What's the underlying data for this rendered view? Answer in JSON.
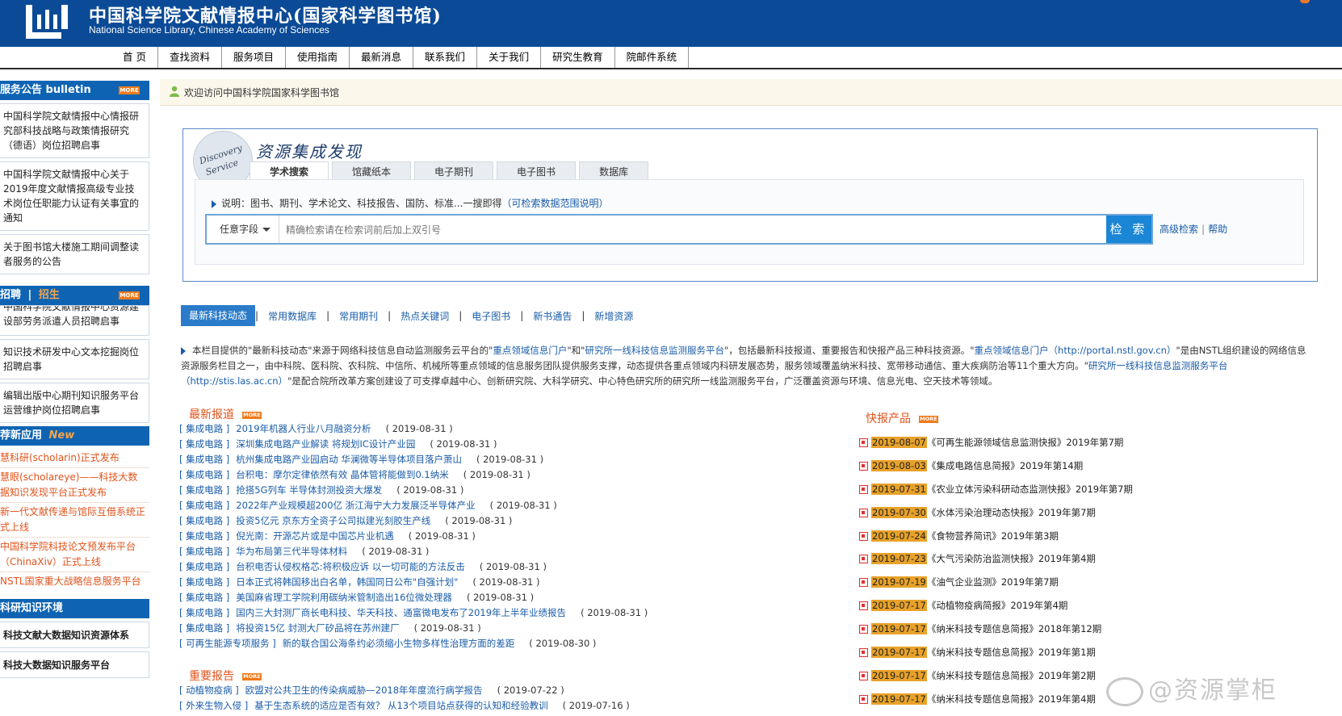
{
  "header": {
    "title": "中国科学院文献情报中心(国家科学图书馆)",
    "subtitle": "National Science Library, Chinese Academy of Sciences"
  },
  "nav": {
    "items": [
      "首 页",
      "查找资料",
      "服务项目",
      "使用指南",
      "最新消息",
      "联系我们",
      "关于我们",
      "研究生教育",
      "院邮件系统"
    ]
  },
  "sidebar": {
    "bulletin_title": "服务公告 bulletin",
    "more_label": "MORE",
    "bulletin_items": [
      "中国科学院文献情报中心情报研究部科技战略与政策情报研究（德语）岗位招聘启事",
      "中国科学院文献情报中心关于2019年度文献情报高级专业技术岗位任职能力认证有关事宜的通知",
      "关于图书馆大楼施工期间调整读者服务的公告"
    ],
    "recruit_title": "招聘",
    "recruit_title_alt": "招生",
    "recruit_partial": "中国科学院文献情报中心资源建设部劳务派遣人员招聘启事",
    "recruit_items": [
      "知识技术研发中心文本挖掘岗位招聘启事",
      "编辑出版中心期刊知识服务平台运营维护岗位招聘启事"
    ],
    "apps_title": "荐新应用",
    "apps_new": "New",
    "apps_items": [
      "慧科研(scholarin)正式发布",
      "慧眼(scholareye)——科技大数据知识发现平台正式发布",
      "新一代文献传递与馆际互借系统正式上线",
      "中国科学院科技论文预发布平台（ChinaXiv）正式上线",
      "NSTL国家重大战略信息服务平台"
    ],
    "knowledge_title": "科研知识环境",
    "knowledge_items": [
      "科技文献大数据知识资源体系",
      "科技大数据知识服务平台"
    ]
  },
  "welcome": {
    "text": "欢迎访问中国科学院国家科学图书馆"
  },
  "search_panel": {
    "badge_line1": "Discovery",
    "badge_line2": "Service",
    "title": "资源集成发现",
    "tabs": [
      "学术搜索",
      "馆藏纸本",
      "电子期刊",
      "电子图书",
      "数据库"
    ],
    "active_tab": 0,
    "hint": "说明：图书、期刊、学术论文、科技报告、国防、标准...一搜即得",
    "hint_link": "（可检索数据范围说明）",
    "field_select": "任意字段",
    "placeholder": "精确检索请在检索词前后加上双引号",
    "search_button": "检 索",
    "advanced": "高级检索",
    "help": "帮助"
  },
  "news_tabs": {
    "items": [
      "最新科技动态",
      "常用数据库",
      "常用期刊",
      "热点关键词",
      "电子图书",
      "新书通告",
      "新增资源"
    ],
    "active": 0
  },
  "intro": {
    "p1": "本栏目提供的\"最新科技动态\"来源于网络科技信息自动监测服务云平台的\"",
    "l1": "重点领域信息门户",
    "p2": "\"和\"",
    "l2": "研究所一线科技信息监测服务平台",
    "p3": "\"，包括最新科技报道、重要报告和快报产品三种科技资源。\"",
    "l3": "重点领域信息门户（http://portal.nstl.gov.cn）",
    "p4": "\"是由NSTL组织建设的网络信息资源服务栏目之一，由中科院、医科院、农科院、中信所、机械所等重点领域的信息服务团队提供服务支撑，动态提供各重点领域内科研发展态势，服务领域覆盖纳米科技、宽带移动通信、重大疾病防治等11个重大方向。\"",
    "l4": "研究所一线科技信息监测服务平台（http://stis.las.ac.cn）",
    "p5": "\"是配合院所改革方案创建设了可支撑卓越中心、创新研究院、大科学研究、中心特色研究所的研究所一线监测服务平台，广泛覆盖资源与环境、信息光电、空天技术等领域。"
  },
  "latest": {
    "title": "最新报道",
    "items": [
      {
        "cat": "[ 集成电路 ]",
        "title": "2019年机器人行业八月融资分析",
        "date": "( 2019-08-31 )"
      },
      {
        "cat": "[ 集成电路 ]",
        "title": "深圳集成电路产业解读 将规划IC设计产业园",
        "date": "( 2019-08-31 )"
      },
      {
        "cat": "[ 集成电路 ]",
        "title": "杭州集成电路产业园启动 华澜微等半导体项目落户萧山",
        "date": "( 2019-08-31 )"
      },
      {
        "cat": "[ 集成电路 ]",
        "title": "台积电：摩尔定律依然有效 晶体管将能做到0.1纳米",
        "date": "( 2019-08-31 )"
      },
      {
        "cat": "[ 集成电路 ]",
        "title": "抢搭5G列车 半导体封测投资大爆发",
        "date": "( 2019-08-31 )"
      },
      {
        "cat": "[ 集成电路 ]",
        "title": "2022年产业规模超200亿 浙江海宁大力发展泛半导体产业",
        "date": "( 2019-08-31 )"
      },
      {
        "cat": "[ 集成电路 ]",
        "title": "投资5亿元 京东方全资子公司拟建光刻胶生产线",
        "date": "( 2019-08-31 )"
      },
      {
        "cat": "[ 集成电路 ]",
        "title": "倪光南：开源芯片或是中国芯片业机遇",
        "date": "( 2019-08-31 )"
      },
      {
        "cat": "[ 集成电路 ]",
        "title": "华为布局第三代半导体材料",
        "date": "( 2019-08-31 )"
      },
      {
        "cat": "[ 集成电路 ]",
        "title": "台积电否认侵权格芯:将积极应诉 以一切可能的方法反击",
        "date": "( 2019-08-31 )"
      },
      {
        "cat": "[ 集成电路 ]",
        "title": "日本正式将韩国移出白名单，韩国同日公布\"自强计划\"",
        "date": "( 2019-08-31 )"
      },
      {
        "cat": "[ 集成电路 ]",
        "title": "美国麻省理工学院利用碳纳米管制造出16位微处理器",
        "date": "( 2019-08-31 )"
      },
      {
        "cat": "[ 集成电路 ]",
        "title": "国内三大封测厂商长电科技、华天科技、通富微电发布了2019年上半年业绩报告",
        "date": "( 2019-08-31 )"
      },
      {
        "cat": "[ 集成电路 ]",
        "title": "将投资15亿 封测大厂矽品将在苏州建厂",
        "date": "( 2019-08-31 )"
      },
      {
        "cat": "[ 可再生能源专项服务 ]",
        "title": "新的联合国公海条约必须缩小生物多样性治理方面的差距",
        "date": "( 2019-08-30 )"
      }
    ]
  },
  "reports": {
    "title": "重要报告",
    "items": [
      {
        "cat": "[ 动植物疫病 ]",
        "title": "欧盟对公共卫生的传染病威胁—2018年年度流行病学报告",
        "date": "( 2019-07-22 )"
      },
      {
        "cat": "[ 外来生物入侵 ]",
        "title": "基于生态系统的适应是否有效？ 从13个项目站点获得的认知和经验教训",
        "date": "( 2019-07-16 )"
      }
    ]
  },
  "kuaibao": {
    "title": "快报产品",
    "items": [
      {
        "date": "2019-08-07",
        "title": "《可再生能源领域信息监测快报》2019年第7期"
      },
      {
        "date": "2019-08-03",
        "title": "《集成电路信息简报》2019年第14期"
      },
      {
        "date": "2019-07-31",
        "title": "《农业立体污染科研动态监测快报》2019年第7期"
      },
      {
        "date": "2019-07-30",
        "title": "《水体污染治理动态快报》2019年第7期"
      },
      {
        "date": "2019-07-24",
        "title": "《食物营养简讯》2019年第3期"
      },
      {
        "date": "2019-07-23",
        "title": "《大气污染防治监测快报》2019年第4期"
      },
      {
        "date": "2019-07-19",
        "title": "《油气企业监测》2019年第7期"
      },
      {
        "date": "2019-07-17",
        "title": "《动植物疫病简报》2019年第4期"
      },
      {
        "date": "2019-07-17",
        "title": "《纳米科技专题信息简报》2018年第12期"
      },
      {
        "date": "2019-07-17",
        "title": "《纳米科技专题信息简报》2019年第1期"
      },
      {
        "date": "2019-07-17",
        "title": "《纳米科技专题信息简报》2019年第2期"
      },
      {
        "date": "2019-07-17",
        "title": "《纳米科技专题信息简报》2019年第4期"
      }
    ]
  },
  "watermark": {
    "text": "@资源掌柜"
  }
}
